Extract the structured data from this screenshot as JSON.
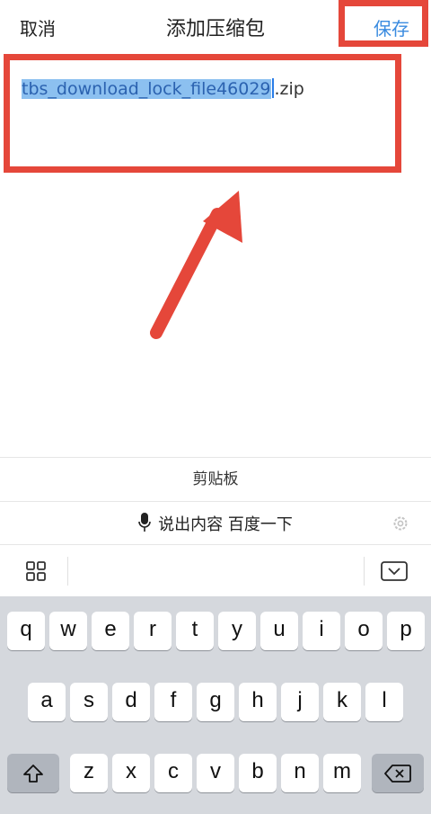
{
  "header": {
    "cancel_label": "取消",
    "title": "添加压缩包",
    "save_label": "保存"
  },
  "filename": {
    "selected": "tbs_download_lock_file46029",
    "extension": ".zip"
  },
  "keyboard_bar": {
    "clipboard_label": "剪贴板",
    "voice_label": "说出内容 百度一下"
  },
  "icons": {
    "mic": "microphone-icon",
    "gear": "gear-icon",
    "grid": "grid-icon",
    "hide_keyboard": "keyboard-hide-icon",
    "shift": "shift-icon",
    "backspace": "backspace-icon"
  },
  "keyboard": {
    "row1": [
      "q",
      "w",
      "e",
      "r",
      "t",
      "y",
      "u",
      "i",
      "o",
      "p"
    ],
    "row2": [
      "a",
      "s",
      "d",
      "f",
      "g",
      "h",
      "j",
      "k",
      "l"
    ],
    "row3": [
      "z",
      "x",
      "c",
      "v",
      "b",
      "n",
      "m"
    ]
  },
  "colors": {
    "accent": "#3a8be0",
    "annotation": "#e5473a",
    "selection": "#8cc0f0"
  }
}
